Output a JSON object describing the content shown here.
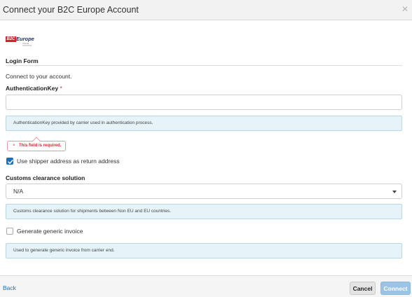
{
  "dialog": {
    "title": "Connect your B2C Europe Account",
    "close_icon": "close-icon"
  },
  "logo": {
    "tag": "B2C",
    "word": "Europe",
    "sub": "ONLINE LOGISTICS"
  },
  "form": {
    "section_title": "Login Form",
    "intro": "Connect to your account.",
    "auth_key": {
      "label": "AuthenticationKey",
      "required_mark": "*",
      "value": "",
      "placeholder": "",
      "help": "AuthenticationKey provided by carrier used in authentication process.",
      "error": "This field is required.",
      "error_icon": "×"
    },
    "use_shipper": {
      "label": "Use shipper address as return address",
      "checked": true
    },
    "customs": {
      "label": "Customs clearance solution",
      "selected": "N/A",
      "help": "Customs clearance solution for shipments between Non EU and EU countries."
    },
    "generic_invoice": {
      "label": "Generate generic invoice",
      "checked": false,
      "help": "Used to generate generic invoice from carrier end."
    }
  },
  "footer": {
    "back_label": "Back",
    "cancel_label": "Cancel",
    "connect_label": "Connect"
  },
  "colors": {
    "accent": "#1f6fb5",
    "error": "#d9262e",
    "help_bg": "#e6f3f9",
    "connect_disabled": "#9cc3e4"
  }
}
